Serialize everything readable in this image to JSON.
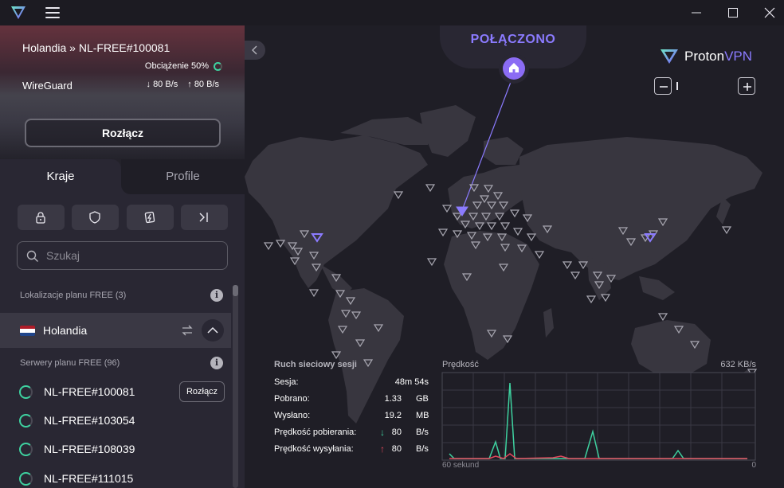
{
  "titlebar": {
    "brand_color": "#8b7bff"
  },
  "connection": {
    "server": "Holandia » NL-FREE#100081",
    "load_label": "Obciążenie 50%",
    "load": 0.5,
    "protocol": "WireGuard",
    "download_speed": "80 B/s",
    "upload_speed": "80 B/s",
    "disconnect_label": "Rozłącz"
  },
  "tabs": {
    "countries": "Kraje",
    "profiles": "Profile"
  },
  "filters": [
    "lock-icon",
    "shield-icon",
    "p2p-icon",
    "tor-icon"
  ],
  "search": {
    "placeholder": "Szukaj"
  },
  "free_locations_label": "Lokalizacje planu FREE (3)",
  "country": {
    "name": "Holandia",
    "flag_colors": [
      "#ae1c28",
      "#ffffff",
      "#21468b"
    ]
  },
  "free_servers_label": "Serwery planu FREE (96)",
  "servers": [
    {
      "name": "NL-FREE#100081",
      "action": "Rozłącz"
    },
    {
      "name": "NL-FREE#103054",
      "action": ""
    },
    {
      "name": "NL-FREE#108039",
      "action": ""
    },
    {
      "name": "NL-FREE#111015",
      "action": ""
    }
  ],
  "map": {
    "status": "POŁĄCZONO",
    "brand_name_1": "Proton",
    "brand_name_2": "VPN",
    "accent_color": "#8b7bff"
  },
  "session": {
    "title": "Ruch sieciowy sesji",
    "rows": [
      {
        "label": "Sesja:",
        "arrow": "",
        "value": "48m 54s",
        "unit": ""
      },
      {
        "label": "Pobrano:",
        "arrow": "",
        "value": "1.33",
        "unit": "GB"
      },
      {
        "label": "Wysłano:",
        "arrow": "",
        "value": "19.2",
        "unit": "MB"
      },
      {
        "label": "Prędkość pobierania:",
        "arrow": "↓",
        "value": "80",
        "unit": "B/s"
      },
      {
        "label": "Prędkość wysyłania:",
        "arrow": "↑",
        "value": "80",
        "unit": "B/s"
      }
    ]
  },
  "speed_graph": {
    "title": "Prędkość",
    "max_label": "632  KB/s",
    "x_left": "60 sekund",
    "x_right": "0",
    "download_color": "#3ed2a0",
    "upload_color": "#e5485d"
  }
}
